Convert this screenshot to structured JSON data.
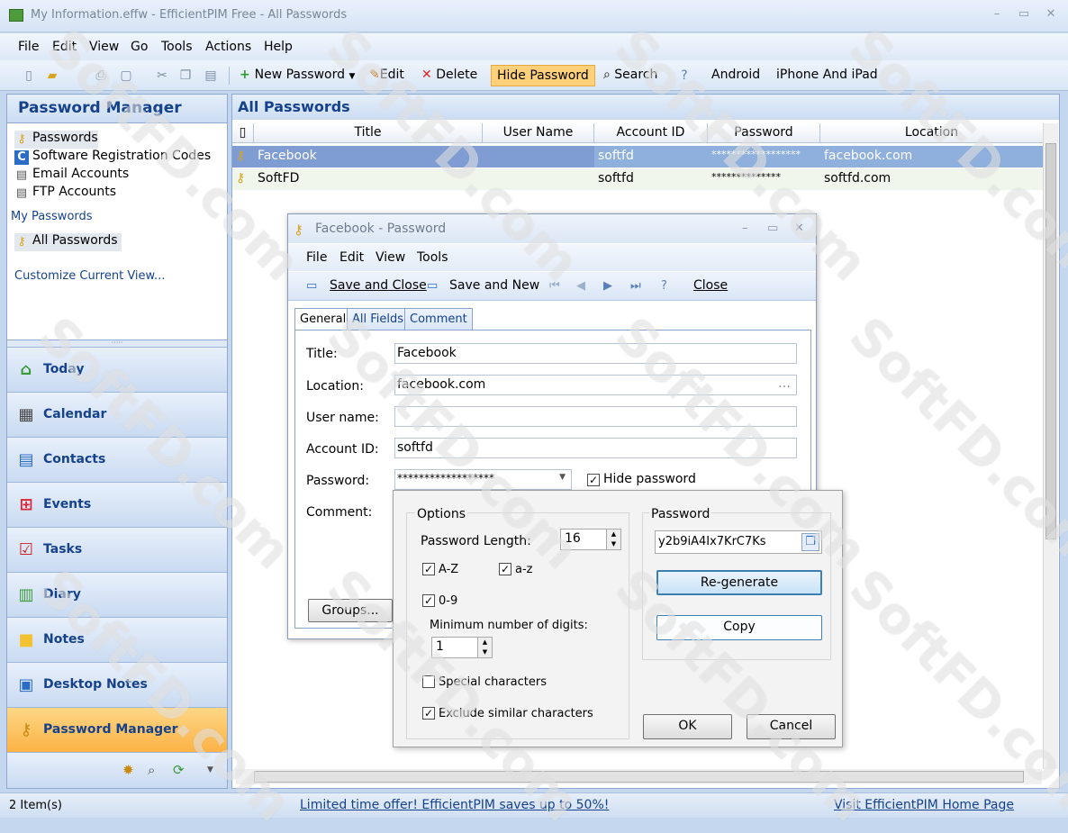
{
  "window": {
    "title": "My Information.effw - EfficientPIM Free - All Passwords"
  },
  "menu": [
    "File",
    "Edit",
    "View",
    "Go",
    "Tools",
    "Actions",
    "Help"
  ],
  "toolbar": {
    "new_password": "New Password",
    "edit": "Edit",
    "delete": "Delete",
    "hide_password": "Hide Password",
    "search": "Search",
    "android": "Android",
    "iphone": "iPhone And iPad"
  },
  "left": {
    "header": "Password Manager",
    "tree": [
      "Passwords",
      "Software Registration Codes",
      "Email Accounts",
      "FTP Accounts"
    ],
    "my_passwords": "My Passwords",
    "all_passwords": "All Passwords",
    "customize": "Customize Current View...",
    "nav": [
      "Today",
      "Calendar",
      "Contacts",
      "Events",
      "Tasks",
      "Diary",
      "Notes",
      "Desktop Notes",
      "Password Manager"
    ]
  },
  "main": {
    "header": "All Passwords",
    "columns": [
      "Title",
      "User Name",
      "Account ID",
      "Password",
      "Location"
    ],
    "rows": [
      {
        "title": "Facebook",
        "user": "",
        "account": "softfd",
        "password": "******************",
        "location": "facebook.com"
      },
      {
        "title": "SoftFD",
        "user": "",
        "account": "softfd",
        "password": "**************",
        "location": "softfd.com"
      }
    ]
  },
  "dialog": {
    "title": "Facebook - Password",
    "menu": [
      "File",
      "Edit",
      "View",
      "Tools"
    ],
    "save_close": "Save and Close",
    "save_new": "Save and New",
    "close": "Close",
    "tabs": [
      "General",
      "All Fields",
      "Comment"
    ],
    "labels": {
      "title": "Title:",
      "location": "Location:",
      "user": "User name:",
      "account": "Account ID:",
      "password": "Password:",
      "comment": "Comment:"
    },
    "values": {
      "title": "Facebook",
      "location": "facebook.com",
      "user": "",
      "account": "softfd",
      "password": "******************"
    },
    "hide_password": "Hide password",
    "groups": "Groups..."
  },
  "generator": {
    "options": "Options",
    "length_label": "Password Length:",
    "length": "16",
    "az_upper": "A-Z",
    "az_lower": "a-z",
    "digits": "0-9",
    "min_digits_label": "Minimum number of digits:",
    "min_digits": "1",
    "special": "Special characters",
    "exclude": "Exclude similar characters",
    "password_label": "Password",
    "password": "y2b9iA4Ix7KrC7Ks",
    "regenerate": "Re-generate",
    "copy": "Copy",
    "ok": "OK",
    "cancel": "Cancel"
  },
  "status": {
    "items": "2 Item(s)",
    "offer": "Limited time offer! EfficientPIM saves up to 50%!",
    "home": "Visit EfficientPIM Home Page"
  },
  "watermark": "SoftFD.com",
  "colors": {
    "accent": "#15428b",
    "active_nav": "#fbb245",
    "selected_row": "#7f9dd3"
  }
}
